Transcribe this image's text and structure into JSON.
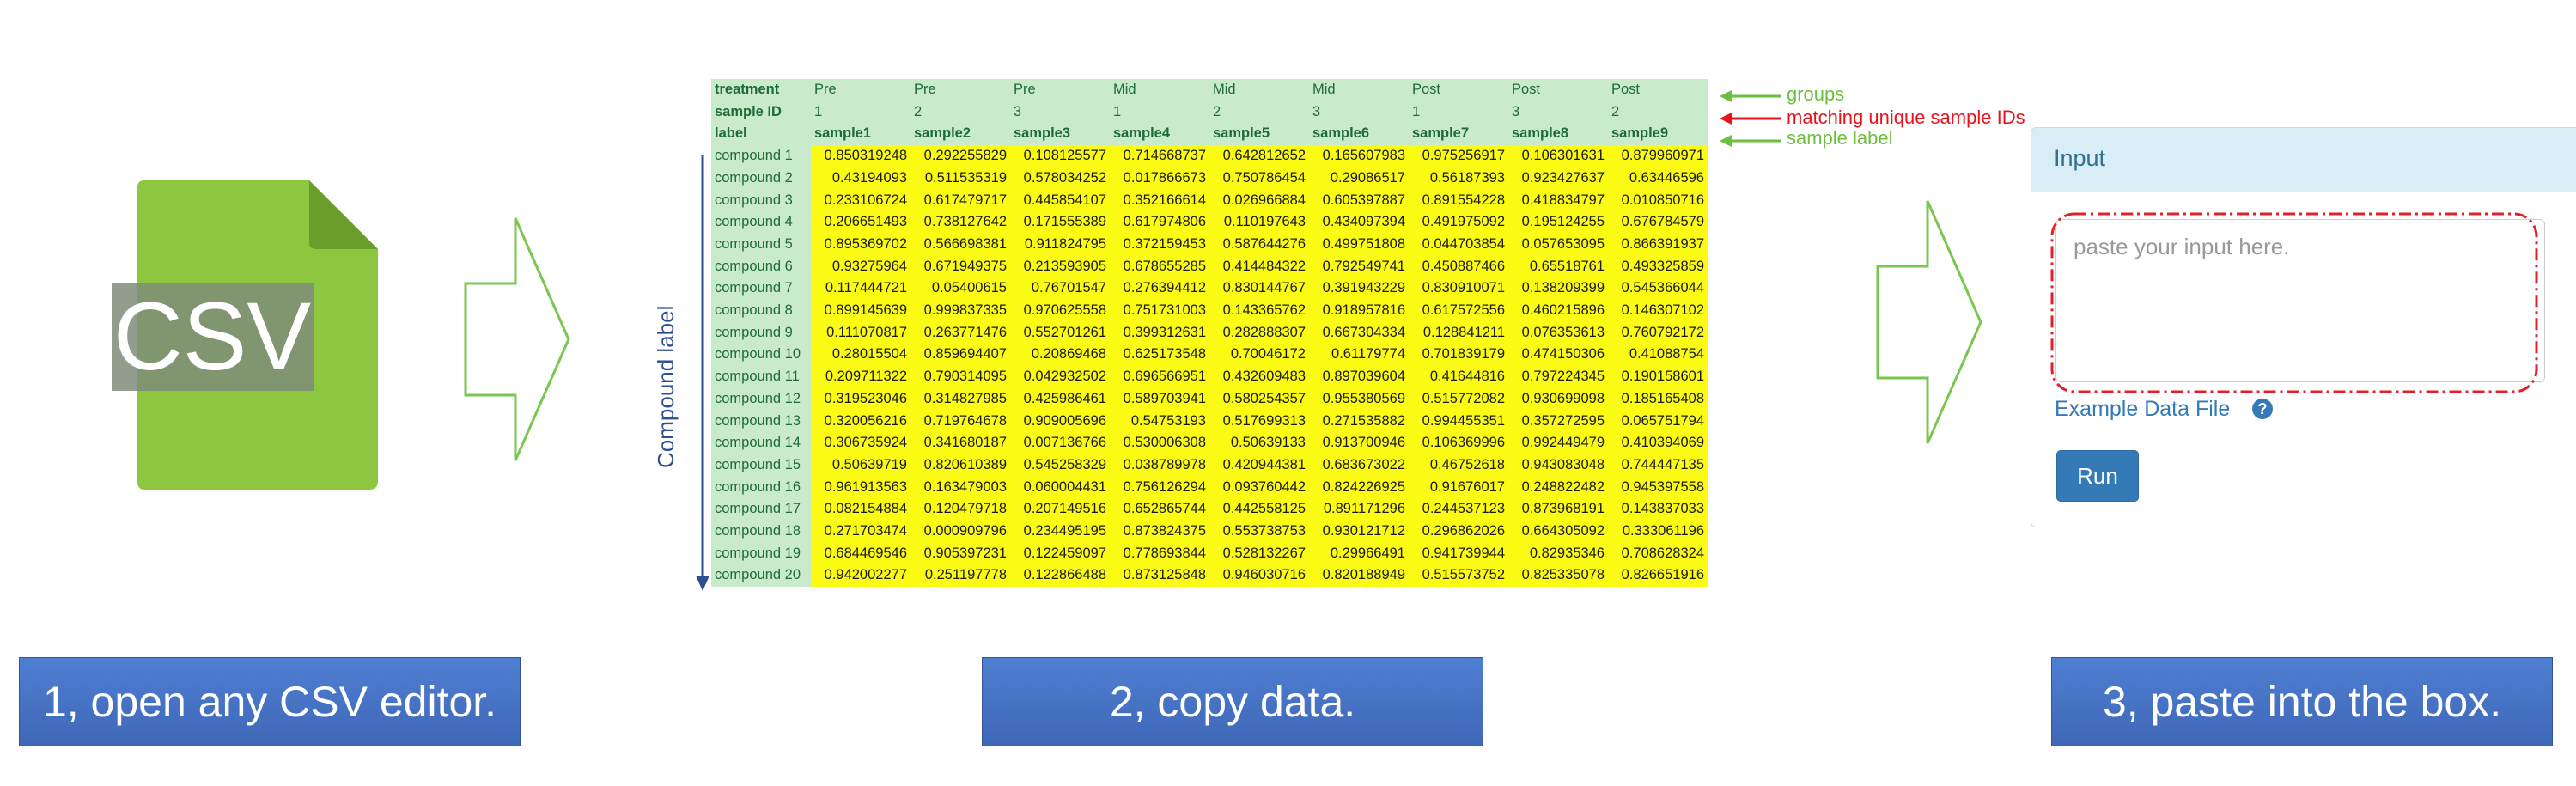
{
  "icon": {
    "text": "CSV",
    "name": "csv-file-icon",
    "color": "#8dc63f"
  },
  "table": {
    "meta_rows": [
      {
        "header": "treatment",
        "values": [
          "Pre",
          "Pre",
          "Pre",
          "Mid",
          "Mid",
          "Mid",
          "Post",
          "Post",
          "Post"
        ]
      },
      {
        "header": "sample ID",
        "values": [
          "1",
          "2",
          "3",
          "1",
          "2",
          "3",
          "1",
          "3",
          "2"
        ]
      },
      {
        "header": "label",
        "values": [
          "sample1",
          "sample2",
          "sample3",
          "sample4",
          "sample5",
          "sample6",
          "sample7",
          "sample8",
          "sample9"
        ]
      }
    ],
    "rows": [
      {
        "label": "compound 1",
        "values": [
          "0.850319248",
          "0.292255829",
          "0.108125577",
          "0.714668737",
          "0.642812652",
          "0.165607983",
          "0.975256917",
          "0.106301631",
          "0.879960971"
        ]
      },
      {
        "label": "compound 2",
        "values": [
          "0.43194093",
          "0.511535319",
          "0.578034252",
          "0.017866673",
          "0.750786454",
          "0.29086517",
          "0.56187393",
          "0.923427637",
          "0.63446596"
        ]
      },
      {
        "label": "compound 3",
        "values": [
          "0.233106724",
          "0.617479717",
          "0.445854107",
          "0.352166614",
          "0.026966884",
          "0.605397887",
          "0.891554228",
          "0.418834797",
          "0.010850716"
        ]
      },
      {
        "label": "compound 4",
        "values": [
          "0.206651493",
          "0.738127642",
          "0.171555389",
          "0.617974806",
          "0.110197643",
          "0.434097394",
          "0.491975092",
          "0.195124255",
          "0.676784579"
        ]
      },
      {
        "label": "compound 5",
        "values": [
          "0.895369702",
          "0.566698381",
          "0.911824795",
          "0.372159453",
          "0.587644276",
          "0.499751808",
          "0.044703854",
          "0.057653095",
          "0.866391937"
        ]
      },
      {
        "label": "compound 6",
        "values": [
          "0.93275964",
          "0.671949375",
          "0.213593905",
          "0.678655285",
          "0.414484322",
          "0.792549741",
          "0.450887466",
          "0.65518761",
          "0.493325859"
        ]
      },
      {
        "label": "compound 7",
        "values": [
          "0.117444721",
          "0.05400615",
          "0.76701547",
          "0.276394412",
          "0.830144767",
          "0.391943229",
          "0.830910071",
          "0.138209399",
          "0.545366044"
        ]
      },
      {
        "label": "compound 8",
        "values": [
          "0.899145639",
          "0.999837335",
          "0.970625558",
          "0.751731003",
          "0.143365762",
          "0.918957816",
          "0.617572556",
          "0.460215896",
          "0.146307102"
        ]
      },
      {
        "label": "compound 9",
        "values": [
          "0.111070817",
          "0.263771476",
          "0.552701261",
          "0.399312631",
          "0.282888307",
          "0.667304334",
          "0.128841211",
          "0.076353613",
          "0.760792172"
        ]
      },
      {
        "label": "compound 10",
        "values": [
          "0.28015504",
          "0.859694407",
          "0.20869468",
          "0.625173548",
          "0.70046172",
          "0.61179774",
          "0.701839179",
          "0.474150306",
          "0.41088754"
        ]
      },
      {
        "label": "compound 11",
        "values": [
          "0.209711322",
          "0.790314095",
          "0.042932502",
          "0.696566951",
          "0.432609483",
          "0.897039604",
          "0.41644816",
          "0.797224345",
          "0.190158601"
        ]
      },
      {
        "label": "compound 12",
        "values": [
          "0.319523046",
          "0.314827985",
          "0.425986461",
          "0.589703941",
          "0.580254357",
          "0.955380569",
          "0.515772082",
          "0.930699098",
          "0.185165408"
        ]
      },
      {
        "label": "compound 13",
        "values": [
          "0.320056216",
          "0.719764678",
          "0.909005696",
          "0.54753193",
          "0.517699313",
          "0.271535882",
          "0.994455351",
          "0.357272595",
          "0.065751794"
        ]
      },
      {
        "label": "compound 14",
        "values": [
          "0.306735924",
          "0.341680187",
          "0.007136766",
          "0.530006308",
          "0.50639133",
          "0.913700946",
          "0.106369996",
          "0.992449479",
          "0.410394069"
        ]
      },
      {
        "label": "compound 15",
        "values": [
          "0.50639719",
          "0.820610389",
          "0.545258329",
          "0.038789978",
          "0.420944381",
          "0.683673022",
          "0.46752618",
          "0.943083048",
          "0.744447135"
        ]
      },
      {
        "label": "compound 16",
        "values": [
          "0.961913563",
          "0.163479003",
          "0.060004431",
          "0.756126294",
          "0.093760442",
          "0.824226925",
          "0.91676017",
          "0.248822482",
          "0.945397558"
        ]
      },
      {
        "label": "compound 17",
        "values": [
          "0.082154884",
          "0.120479718",
          "0.207149516",
          "0.652865744",
          "0.442558125",
          "0.891171296",
          "0.244537123",
          "0.873968191",
          "0.143837033"
        ]
      },
      {
        "label": "compound 18",
        "values": [
          "0.271703474",
          "0.000909796",
          "0.234495195",
          "0.873824375",
          "0.553738753",
          "0.930121712",
          "0.296862026",
          "0.664305092",
          "0.333061196"
        ]
      },
      {
        "label": "compound 19",
        "values": [
          "0.684469546",
          "0.905397231",
          "0.122459097",
          "0.778693844",
          "0.528132267",
          "0.29966491",
          "0.941739944",
          "0.82935346",
          "0.708628324"
        ]
      },
      {
        "label": "compound 20",
        "values": [
          "0.942002277",
          "0.251197778",
          "0.122866488",
          "0.873125848",
          "0.946030716",
          "0.820188949",
          "0.515573752",
          "0.825335078",
          "0.826651916"
        ]
      }
    ]
  },
  "annotations": {
    "groups": "groups",
    "matching": "matching unique sample IDs",
    "sample_label": "sample label",
    "compound_label": "Compound label",
    "green": "#6cbf3c",
    "red": "#e8141d",
    "blue": "#2e4f8f"
  },
  "panel": {
    "title": "Input",
    "placeholder": "paste your input here.",
    "example_link": "Example Data File",
    "help_icon": "?",
    "run_label": "Run"
  },
  "steps": {
    "step1": "1, open any CSV editor.",
    "step2": "2, copy data.",
    "step3": "3, paste into the box."
  }
}
